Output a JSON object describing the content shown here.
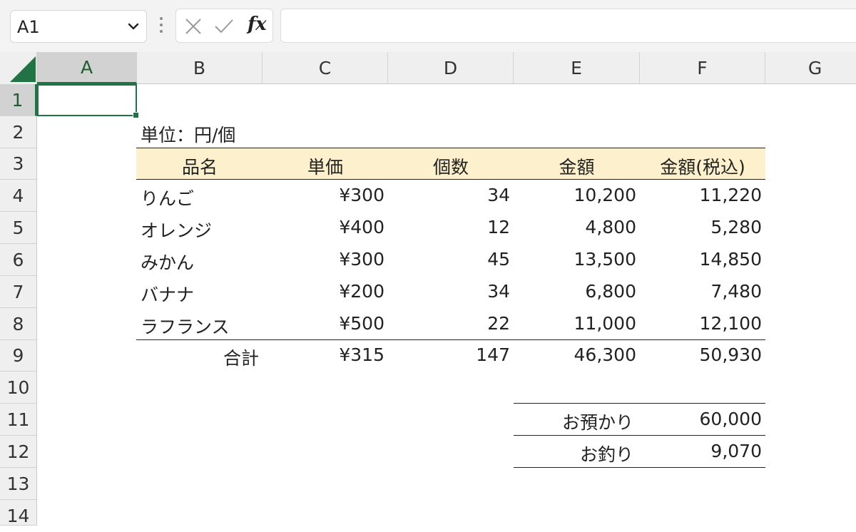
{
  "formula_bar": {
    "name_box": "A1",
    "formula": "",
    "fx_label": "fx"
  },
  "columns": [
    "A",
    "B",
    "C",
    "D",
    "E",
    "F",
    "G"
  ],
  "rows": [
    "1",
    "2",
    "3",
    "4",
    "5",
    "6",
    "7",
    "8",
    "9",
    "10",
    "11",
    "12",
    "13",
    "14"
  ],
  "sheet": {
    "unit_label": "単位：円/個",
    "headers": [
      "品名",
      "単価",
      "個数",
      "金額",
      "金額(税込)"
    ],
    "items": [
      {
        "name": "りんご",
        "price": "¥300",
        "qty": "34",
        "amount": "10,200",
        "amount_tax": "11,220"
      },
      {
        "name": "オレンジ",
        "price": "¥400",
        "qty": "12",
        "amount": "4,800",
        "amount_tax": "5,280"
      },
      {
        "name": "みかん",
        "price": "¥300",
        "qty": "45",
        "amount": "13,500",
        "amount_tax": "14,850"
      },
      {
        "name": "バナナ",
        "price": "¥200",
        "qty": "34",
        "amount": "6,800",
        "amount_tax": "7,480"
      },
      {
        "name": "ラフランス",
        "price": "¥500",
        "qty": "22",
        "amount": "11,000",
        "amount_tax": "12,100"
      }
    ],
    "total": {
      "label": "合計",
      "price": "¥315",
      "qty": "147",
      "amount": "46,300",
      "amount_tax": "50,930"
    },
    "payment": {
      "received_label": "お預かり",
      "received": "60,000",
      "change_label": "お釣り",
      "change": "9,070"
    }
  },
  "colors": {
    "accent": "#217346",
    "header_fill": "#fdf0cc"
  }
}
